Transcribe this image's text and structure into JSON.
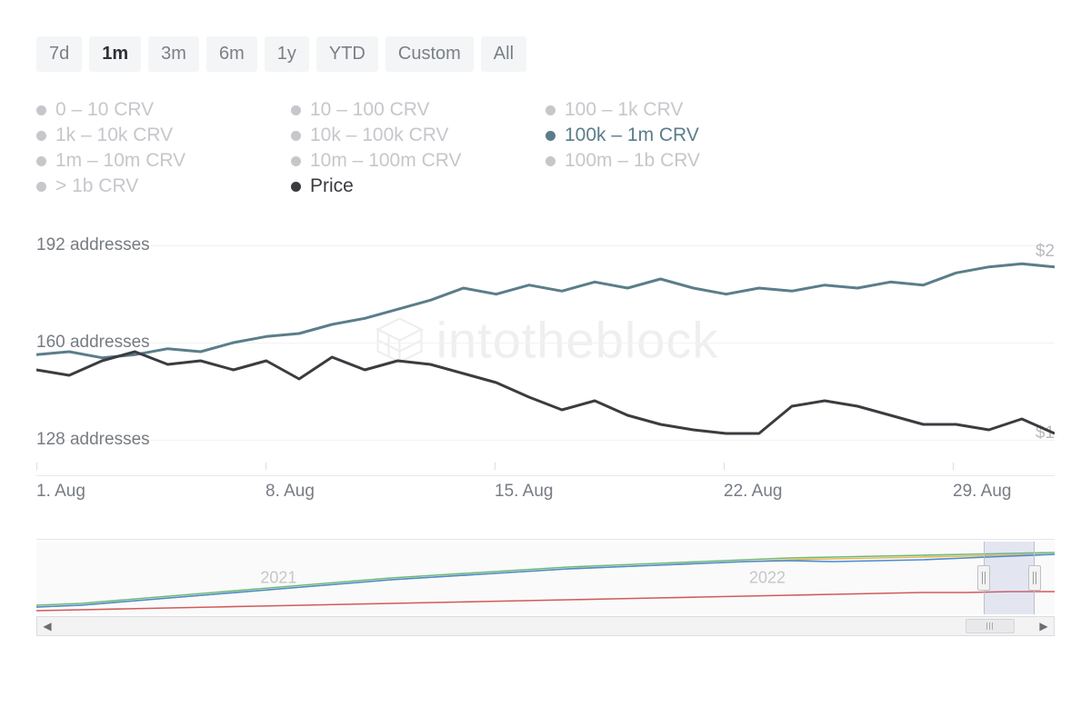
{
  "ranges": {
    "items": [
      "7d",
      "1m",
      "3m",
      "6m",
      "1y",
      "YTD",
      "Custom",
      "All"
    ],
    "active_index": 1
  },
  "legend": {
    "items": [
      {
        "label": "0 – 10 CRV",
        "state": "off"
      },
      {
        "label": "10 – 100 CRV",
        "state": "off"
      },
      {
        "label": "100 – 1k CRV",
        "state": "off"
      },
      {
        "label": "1k – 10k CRV",
        "state": "off"
      },
      {
        "label": "10k – 100k CRV",
        "state": "off"
      },
      {
        "label": "100k – 1m CRV",
        "state": "teal"
      },
      {
        "label": "1m – 10m CRV",
        "state": "off"
      },
      {
        "label": "10m – 100m CRV",
        "state": "off"
      },
      {
        "label": "100m – 1b CRV",
        "state": "off"
      },
      {
        "label": "> 1b CRV",
        "state": "off"
      },
      {
        "label": "Price",
        "state": "black"
      }
    ]
  },
  "watermark": "intotheblock",
  "chart_data": {
    "type": "line",
    "x_ticks": [
      "1. Aug",
      "8. Aug",
      "15. Aug",
      "22. Aug",
      "29. Aug"
    ],
    "y_left": {
      "label_suffix": " addresses",
      "ticks": [
        128,
        160,
        192
      ],
      "range": [
        118,
        196
      ]
    },
    "y_right": {
      "prefix": "$",
      "ticks": [
        1,
        2
      ],
      "range": [
        0.8,
        2.1
      ]
    },
    "series": [
      {
        "name": "100k – 1m CRV",
        "axis": "left",
        "color": "#5b7d8a",
        "x": [
          "1. Aug",
          "2. Aug",
          "3. Aug",
          "4. Aug",
          "5. Aug",
          "6. Aug",
          "7. Aug",
          "8. Aug",
          "9. Aug",
          "10. Aug",
          "11. Aug",
          "12. Aug",
          "13. Aug",
          "14. Aug",
          "15. Aug",
          "16. Aug",
          "17. Aug",
          "18. Aug",
          "19. Aug",
          "20. Aug",
          "21. Aug",
          "22. Aug",
          "23. Aug",
          "24. Aug",
          "25. Aug",
          "26. Aug",
          "27. Aug",
          "28. Aug",
          "29. Aug",
          "30. Aug",
          "31. Aug",
          "1. Sep"
        ],
        "values": [
          156,
          157,
          155,
          156,
          158,
          157,
          160,
          162,
          163,
          166,
          168,
          171,
          174,
          178,
          176,
          179,
          177,
          180,
          178,
          181,
          178,
          176,
          178,
          177,
          179,
          178,
          180,
          179,
          183,
          185,
          186,
          185
        ]
      },
      {
        "name": "Price",
        "axis": "right",
        "color": "#3a3c40",
        "x": [
          "1. Aug",
          "2. Aug",
          "3. Aug",
          "4. Aug",
          "5. Aug",
          "6. Aug",
          "7. Aug",
          "8. Aug",
          "9. Aug",
          "10. Aug",
          "11. Aug",
          "12. Aug",
          "13. Aug",
          "14. Aug",
          "15. Aug",
          "16. Aug",
          "17. Aug",
          "18. Aug",
          "19. Aug",
          "20. Aug",
          "21. Aug",
          "22. Aug",
          "23. Aug",
          "24. Aug",
          "25. Aug",
          "26. Aug",
          "27. Aug",
          "28. Aug",
          "29. Aug",
          "30. Aug",
          "31. Aug",
          "1. Sep"
        ],
        "values": [
          1.35,
          1.32,
          1.4,
          1.45,
          1.38,
          1.4,
          1.35,
          1.4,
          1.3,
          1.42,
          1.35,
          1.4,
          1.38,
          1.33,
          1.28,
          1.2,
          1.13,
          1.18,
          1.1,
          1.05,
          1.02,
          1.0,
          1.0,
          1.15,
          1.18,
          1.15,
          1.1,
          1.05,
          1.05,
          1.02,
          1.08,
          1.0
        ]
      }
    ]
  },
  "navigator": {
    "year_labels": [
      "2021",
      "2022"
    ],
    "window": {
      "start_pct": 93,
      "end_pct": 98
    }
  }
}
